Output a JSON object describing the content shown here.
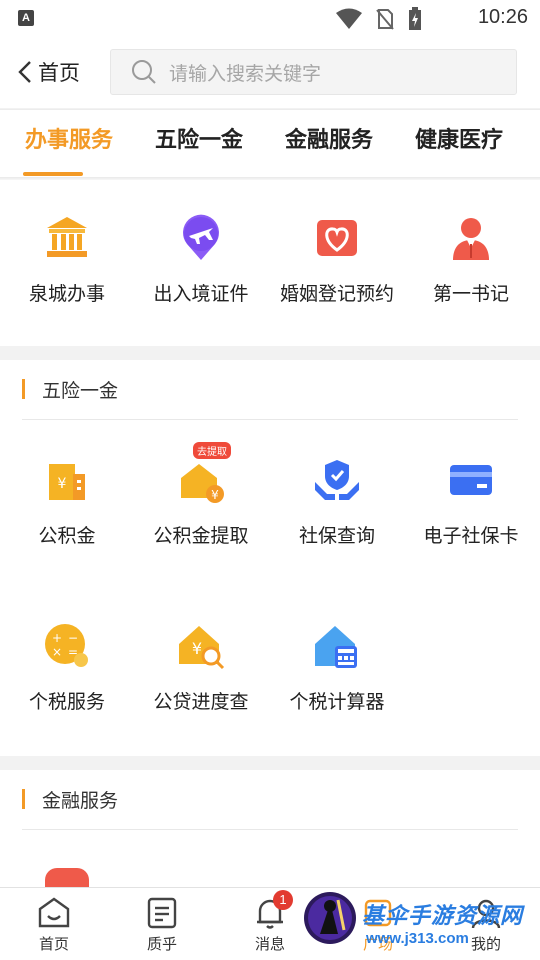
{
  "status_bar": {
    "time": "10:26"
  },
  "nav": {
    "back_label": "首页",
    "search_placeholder": "请输入搜索关键字"
  },
  "tabs": [
    {
      "label": "办事服务",
      "active": true
    },
    {
      "label": "五险一金"
    },
    {
      "label": "金融服务"
    },
    {
      "label": "健康医疗"
    }
  ],
  "services": [
    {
      "label": "泉城办事",
      "icon": "bank-building-icon"
    },
    {
      "label": "出入境证件",
      "icon": "airplane-pin-icon"
    },
    {
      "label": "婚姻登记预约",
      "icon": "heart-certificate-icon"
    },
    {
      "label": "第一书记",
      "icon": "official-person-icon"
    }
  ],
  "five_insurance": {
    "title": "五险一金",
    "badge": "去提取",
    "items": [
      {
        "label": "公积金",
        "icon": "housing-fund-building-icon"
      },
      {
        "label": "公积金提取",
        "icon": "fund-withdraw-house-icon"
      },
      {
        "label": "社保查询",
        "icon": "shield-hands-icon"
      },
      {
        "label": "电子社保卡",
        "icon": "social-card-icon"
      },
      {
        "label": "个税服务",
        "icon": "tax-calculator-coin-icon"
      },
      {
        "label": "公贷进度查",
        "icon": "loan-house-search-icon"
      },
      {
        "label": "个税计算器",
        "icon": "house-calculator-icon"
      }
    ]
  },
  "finance": {
    "title": "金融服务"
  },
  "bottom_nav": [
    {
      "label": "首页",
      "icon": "home-icon"
    },
    {
      "label": "质乎",
      "icon": "document-icon"
    },
    {
      "label": "消息",
      "icon": "bell-icon",
      "badge": "1"
    },
    {
      "label": "广场",
      "icon": "square-icon"
    },
    {
      "label": "我的",
      "icon": "profile-icon"
    }
  ],
  "watermark": {
    "text": "基伞手游资源网",
    "url": "www.j313.com"
  },
  "colors": {
    "accent": "#f39a26",
    "blue": "#3b6ff2",
    "red": "#ef5a4a",
    "purple": "#7b4cf0"
  }
}
